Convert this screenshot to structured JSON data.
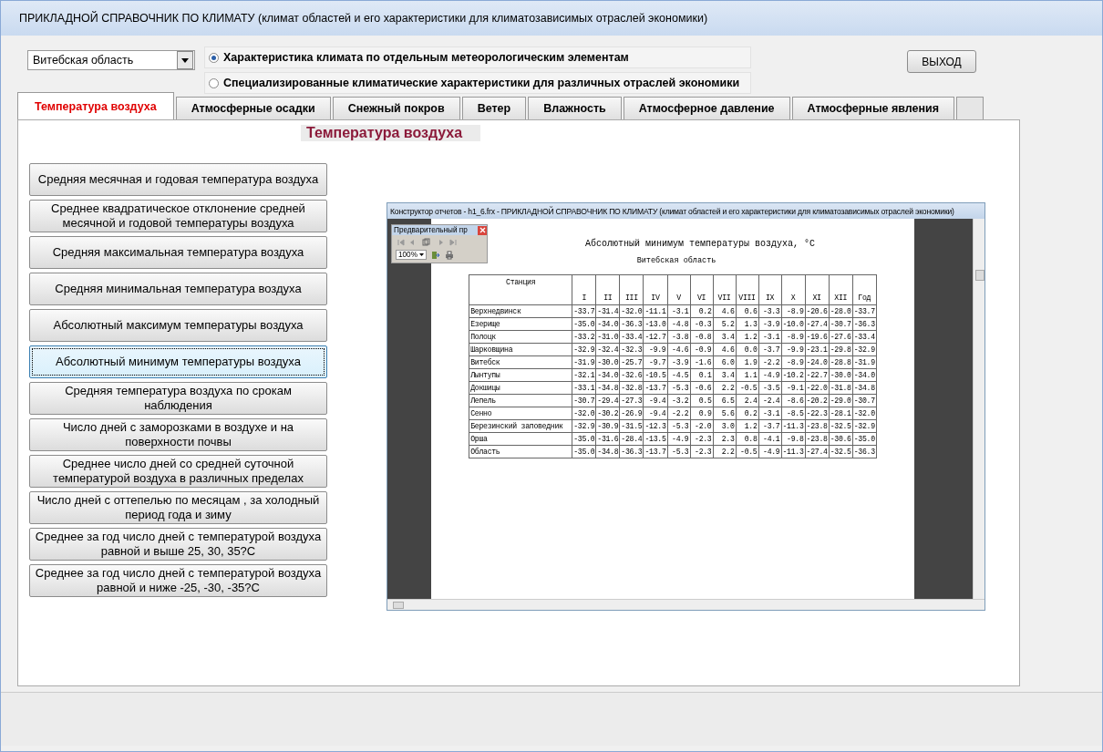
{
  "window": {
    "title": "ПРИКЛАДНОЙ СПРАВОЧНИК ПО КЛИМАТУ (климат  областей и его характеристики для климатозависимых отраслей экономики)"
  },
  "region_select": {
    "value": "Витебская область"
  },
  "modes": [
    {
      "label": "Характеристика климата по отдельным   метеорологическим элементам",
      "selected": true
    },
    {
      "label": "Специализированные климатические характеристики для различных отраслей экономики",
      "selected": false
    }
  ],
  "exit_button": "ВЫХОД",
  "tabs": [
    {
      "label": "Температура воздуха",
      "selected": true
    },
    {
      "label": "Атмосферные осадки",
      "selected": false
    },
    {
      "label": "Снежный покров",
      "selected": false
    },
    {
      "label": "Ветер",
      "selected": false
    },
    {
      "label": "Влажность",
      "selected": false
    },
    {
      "label": "Атмосферное давление",
      "selected": false
    },
    {
      "label": "Атмосферные явления",
      "selected": false
    }
  ],
  "section_title": "Температура воздуха",
  "report_buttons": [
    {
      "label": "Средняя месячная и годовая температура воздуха",
      "selected": false
    },
    {
      "label": "Среднее квадратическое отклонение средней месячной и годовой температуры воздуха",
      "selected": false
    },
    {
      "label": "Средняя максимальная температура воздуха",
      "selected": false
    },
    {
      "label": "Средняя минимальная температура воздуха",
      "selected": false
    },
    {
      "label": "Абсолютный максимум температуры воздуха",
      "selected": false
    },
    {
      "label": "Абсолютный минимум температуры воздуха",
      "selected": true
    },
    {
      "label": "Средняя температура воздуха по срокам наблюдения",
      "selected": false
    },
    {
      "label": "Число дней с заморозками в воздухе и на поверхности почвы",
      "selected": false
    },
    {
      "label": "Среднее число дней со средней суточной температурой воздуха в различных пределах",
      "selected": false
    },
    {
      "label": "Число дней с оттепелью по месяцам , за холодный период года и зиму",
      "selected": false
    },
    {
      "label": "Среднее за год число дней с температурой воздуха равной и выше 25, 30, 35?С",
      "selected": false
    },
    {
      "label": "Среднее за год число дней с температурой воздуха равной и ниже -25, -30, -35?С",
      "selected": false
    }
  ],
  "report_window": {
    "title": "Конструктор отчетов - h1_6.frx - ПРИКЛАДНОЙ СПРАВОЧНИК ПО КЛИМАТУ (климат  областей и его характеристики для климатозависимых отраслей экономики)",
    "preview_toolbar": {
      "title": "Предварительный пр",
      "zoom": "100%"
    },
    "report": {
      "title": "Абсолютный минимум температуры воздуха, °C",
      "subtitle": "Витебская область",
      "columns": [
        "Станция",
        "I",
        "II",
        "III",
        "IV",
        "V",
        "VI",
        "VII",
        "VIII",
        "IX",
        "X",
        "XI",
        "XII",
        "Год"
      ],
      "rows": [
        {
          "station": "Верхнедвинск",
          "values": [
            "-33.7",
            "-31.4",
            "-32.0",
            "-11.1",
            "-3.1",
            "0.2",
            "4.6",
            "0.6",
            "-3.3",
            "-8.9",
            "-20.6",
            "-28.0",
            "-33.7"
          ]
        },
        {
          "station": "Езерище",
          "values": [
            "-35.0",
            "-34.0",
            "-36.3",
            "-13.0",
            "-4.8",
            "-0.3",
            "5.2",
            "1.3",
            "-3.9",
            "-10.0",
            "-27.4",
            "-30.7",
            "-36.3"
          ]
        },
        {
          "station": "Полоцк",
          "values": [
            "-33.2",
            "-31.0",
            "-33.4",
            "-12.7",
            "-3.8",
            "-0.8",
            "3.4",
            "1.2",
            "-3.1",
            "-8.9",
            "-19.6",
            "-27.6",
            "-33.4"
          ]
        },
        {
          "station": "Шарковщина",
          "values": [
            "-32.9",
            "-32.4",
            "-32.3",
            "-9.9",
            "-4.6",
            "-0.9",
            "4.6",
            "0.0",
            "-3.7",
            "-9.9",
            "-23.1",
            "-29.8",
            "-32.9"
          ]
        },
        {
          "station": "Витебск",
          "values": [
            "-31.9",
            "-30.0",
            "-25.7",
            "-9.7",
            "-3.9",
            "-1.6",
            "6.0",
            "1.9",
            "-2.2",
            "-8.9",
            "-24.0",
            "-28.8",
            "-31.9"
          ]
        },
        {
          "station": "Лынтупы",
          "values": [
            "-32.1",
            "-34.0",
            "-32.6",
            "-10.5",
            "-4.5",
            "0.1",
            "3.4",
            "1.1",
            "-4.9",
            "-10.2",
            "-22.7",
            "-30.0",
            "-34.0"
          ]
        },
        {
          "station": "Докшицы",
          "values": [
            "-33.1",
            "-34.8",
            "-32.8",
            "-13.7",
            "-5.3",
            "-0.6",
            "2.2",
            "-0.5",
            "-3.5",
            "-9.1",
            "-22.0",
            "-31.8",
            "-34.8"
          ]
        },
        {
          "station": "Лепель",
          "values": [
            "-30.7",
            "-29.4",
            "-27.3",
            "-9.4",
            "-3.2",
            "0.5",
            "6.5",
            "2.4",
            "-2.4",
            "-8.6",
            "-20.2",
            "-29.0",
            "-30.7"
          ]
        },
        {
          "station": "Сенно",
          "values": [
            "-32.0",
            "-30.2",
            "-26.9",
            "-9.4",
            "-2.2",
            "0.9",
            "5.6",
            "0.2",
            "-3.1",
            "-8.5",
            "-22.3",
            "-28.1",
            "-32.0"
          ]
        },
        {
          "station": "Березинский заповедник",
          "values": [
            "-32.9",
            "-30.9",
            "-31.5",
            "-12.3",
            "-5.3",
            "-2.0",
            "3.0",
            "1.2",
            "-3.7",
            "-11.3",
            "-23.8",
            "-32.5",
            "-32.9"
          ]
        },
        {
          "station": "Орша",
          "values": [
            "-35.0",
            "-31.6",
            "-28.4",
            "-13.5",
            "-4.9",
            "-2.3",
            "2.3",
            "0.8",
            "-4.1",
            "-9.8",
            "-23.8",
            "-30.6",
            "-35.0"
          ]
        },
        {
          "station": "Область",
          "values": [
            "-35.0",
            "-34.8",
            "-36.3",
            "-13.7",
            "-5.3",
            "-2.3",
            "2.2",
            "-0.5",
            "-4.9",
            "-11.3",
            "-27.4",
            "-32.5",
            "-36.3"
          ]
        }
      ]
    }
  }
}
